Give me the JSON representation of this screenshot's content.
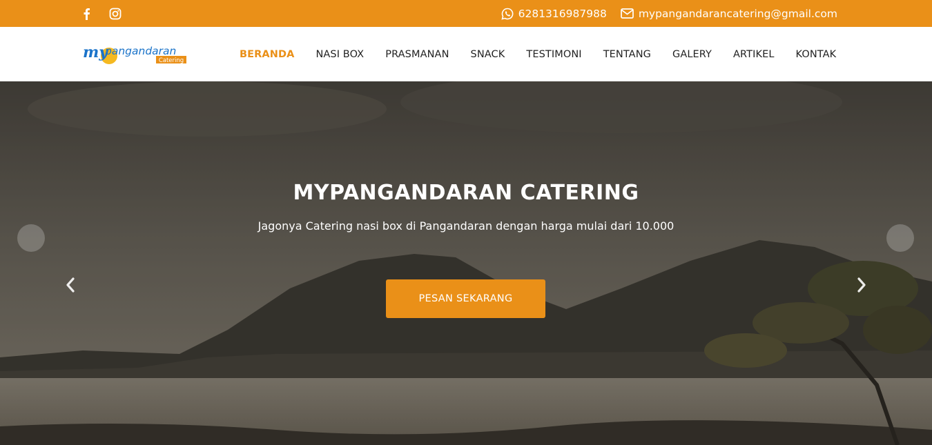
{
  "topbar": {
    "social": [
      {
        "icon": "facebook-icon"
      },
      {
        "icon": "instagram-icon"
      }
    ],
    "phone": "6281316987988",
    "email": "mypangandarancatering@gmail.com"
  },
  "logo": {
    "brand_prefix": "my",
    "brand_name": "pangandaran",
    "tag": "Catering"
  },
  "nav": {
    "items": [
      {
        "label": "BERANDA",
        "active": true
      },
      {
        "label": "NASI BOX"
      },
      {
        "label": "PRASMANAN"
      },
      {
        "label": "SNACK"
      },
      {
        "label": "TESTIMONI"
      },
      {
        "label": "TENTANG"
      },
      {
        "label": "GALERY"
      },
      {
        "label": "ARTIKEL"
      },
      {
        "label": "KONTAK"
      }
    ]
  },
  "hero": {
    "title": "MYPANGANDARAN CATERING",
    "subtitle": "Jagonya Catering nasi box di Pangandaran dengan harga mulai dari 10.000",
    "cta_label": "PESAN SEKARANG"
  },
  "colors": {
    "accent": "#ea9018",
    "logo_blue": "#1a73c9",
    "logo_sun": "#f5b921"
  }
}
